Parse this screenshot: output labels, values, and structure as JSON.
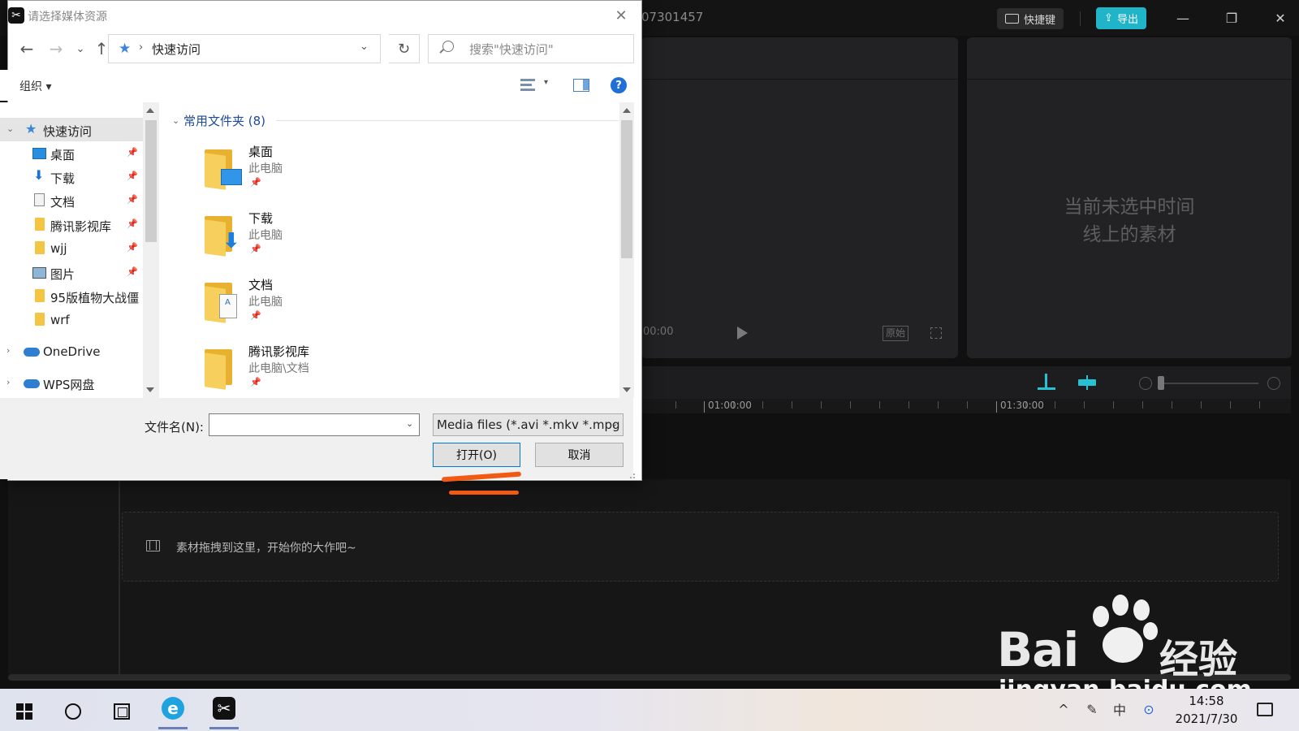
{
  "app": {
    "project_name": "07301457",
    "shortcut_label": "快捷键",
    "export_label": "导出",
    "window_controls": {
      "minimize": "—",
      "restore": "❐",
      "close": "✕"
    },
    "player": {
      "time": "00:00",
      "original_badge": "原始"
    },
    "properties_empty_line1": "当前未选中时间",
    "properties_empty_line2": "线上的素材",
    "ruler_labels": [
      "01:00:00",
      "01:30:00"
    ],
    "dropzone_text": "素材拖拽到这里，开始你的大作吧~",
    "accent_color": "#1fb4c8"
  },
  "dialog": {
    "title": "请选择媒体资源",
    "close_glyph": "✕",
    "nav": {
      "back": "←",
      "forward": "→",
      "recent": "⌄",
      "up": "↑"
    },
    "address": "快速访问",
    "refresh_glyph": "↻",
    "search_placeholder": "搜索\"快速访问\"",
    "organize_label": "组织 ▾",
    "help_glyph": "?",
    "nav_pane": [
      {
        "label": "快速访问",
        "icon": "star-icon",
        "selected": true
      },
      {
        "label": "桌面",
        "icon": "desktop-icon",
        "pinned": true
      },
      {
        "label": "下载",
        "icon": "download-icon",
        "pinned": true
      },
      {
        "label": "文档",
        "icon": "document-icon",
        "pinned": true
      },
      {
        "label": "腾讯影视库",
        "icon": "folder-icon",
        "pinned": true
      },
      {
        "label": "wjj",
        "icon": "folder-icon",
        "pinned": true
      },
      {
        "label": "图片",
        "icon": "pictures-icon",
        "pinned": true
      },
      {
        "label": "95版植物大战僵",
        "icon": "folder-icon"
      },
      {
        "label": "wrf",
        "icon": "folder-icon"
      },
      {
        "label": "OneDrive",
        "icon": "cloud-icon"
      },
      {
        "label": "WPS网盘",
        "icon": "cloud-icon"
      }
    ],
    "group_header": "常用文件夹 (8)",
    "folders": [
      {
        "name": "桌面",
        "location": "此电脑",
        "overlay": "desktop"
      },
      {
        "name": "下载",
        "location": "此电脑",
        "overlay": "download"
      },
      {
        "name": "文档",
        "location": "此电脑",
        "overlay": "document"
      },
      {
        "name": "腾讯影视库",
        "location": "此电脑\\文档",
        "overlay": "none"
      }
    ],
    "filename_label": "文件名(N):",
    "filename_value": "",
    "filter_value": "Media files (*.avi *.mkv *.mpg",
    "open_label": "打开(O)",
    "cancel_label": "取消",
    "annotation_color": "#f25a14"
  },
  "watermark": {
    "brand": "Bai",
    "brand_suffix": "经验",
    "url": "jingyan.baidu.com"
  },
  "taskbar": {
    "time": "14:58",
    "date": "2021/7/30",
    "tray": {
      "chevron": "^",
      "pen": "✎",
      "ime": "中",
      "ime_glyph": "⊙"
    }
  }
}
